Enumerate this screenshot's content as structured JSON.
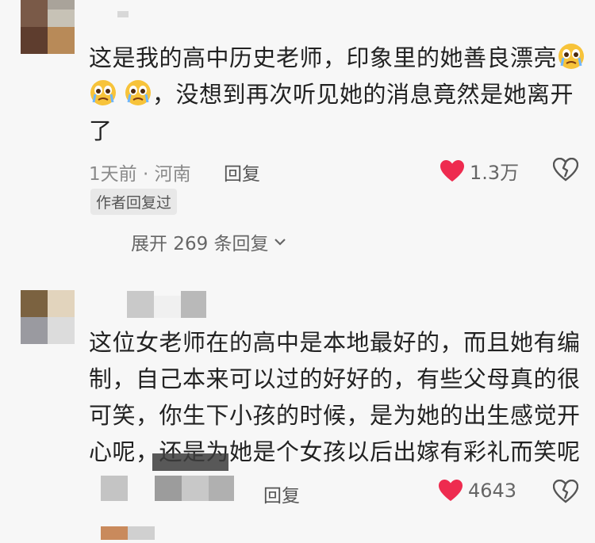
{
  "comment1": {
    "line1": "这是我的高中历史老师，印象里的她善良漂亮",
    "line2": "，没想到再次听见她的消息竟然是她离开",
    "line3": "了",
    "time_location": "1天前 · 河南",
    "reply_label": "回复",
    "like_count": "1.3万",
    "author_badge": "作者回复过",
    "expand_label": "展开 269 条回复"
  },
  "comment2": {
    "line1": "这位女老师在的高中是本地最好的，而且她有编",
    "line2": "制，自己本来可以过的好好的，有些父母真的很",
    "line3": "可笑，你生下小孩的时候，是为她的出生感觉开",
    "line4": "心呢，还是为她是个女孩以后出嫁有彩礼而笑呢",
    "reply_label": "回复",
    "like_count": "4643"
  },
  "colors": {
    "heart": "#ee2b4f",
    "background": "#f7f7f7"
  },
  "icons": {
    "like": "heart-icon",
    "dislike": "broken-heart-icon",
    "emoji": "crying-face-emoji",
    "expand": "chevron-down-icon"
  }
}
